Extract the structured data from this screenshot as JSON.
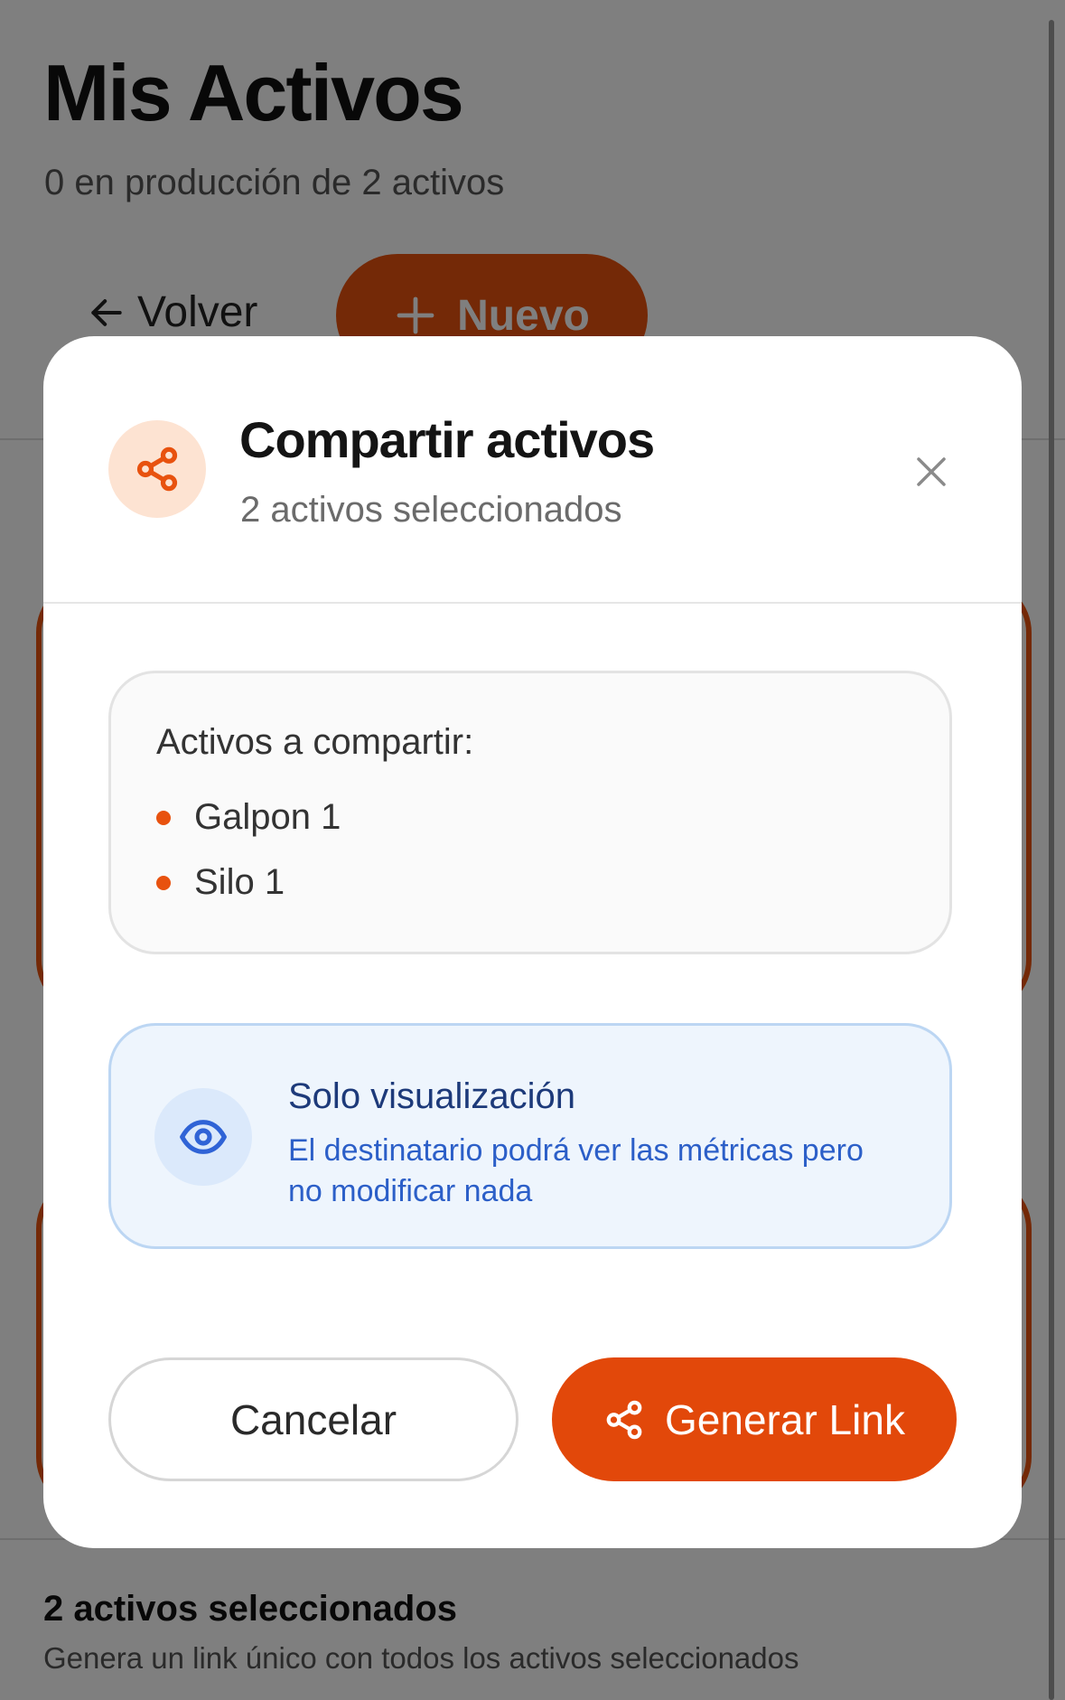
{
  "page": {
    "title": "Mis Activos",
    "subtitle": "0 en producción de 2 activos",
    "back_label": "Volver",
    "new_label": "Nuevo",
    "footer_title": "2 activos seleccionados",
    "footer_subtitle": "Genera un link único con todos los activos seleccionados"
  },
  "modal": {
    "title": "Compartir activos",
    "subtitle": "2 activos seleccionados",
    "assets_heading": "Activos a compartir:",
    "assets": [
      "Galpon 1",
      "Silo 1"
    ],
    "info": {
      "title": "Solo visualización",
      "description": "El destinatario podrá ver las métricas pero no modificar nada"
    },
    "cancel_label": "Cancelar",
    "generate_label": "Generar Link"
  },
  "icons": {
    "header": "share-icon",
    "close": "close-icon",
    "info": "eye-icon",
    "generate": "share-icon",
    "back": "arrow-left-icon",
    "new": "plus-icon"
  },
  "colors": {
    "accent": "#e8520f",
    "accent_soft": "#fde3d2",
    "info_bg": "#eef5fd",
    "info_border": "#bcd6f3",
    "info_title": "#1d3a7a",
    "info_text": "#2c5fc8"
  }
}
